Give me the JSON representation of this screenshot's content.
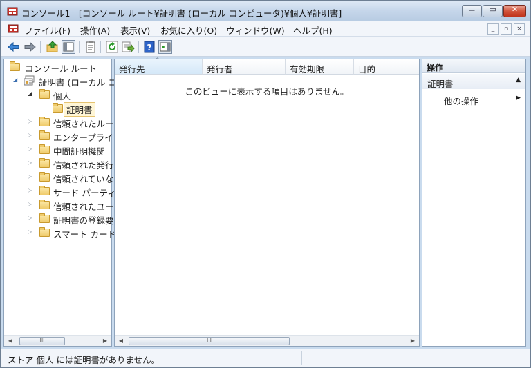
{
  "window": {
    "title": "コンソール1 - [コンソール ルート¥証明書 (ローカル コンピュータ)¥個人¥証明書]"
  },
  "caption_buttons": {
    "minimize": "－",
    "maximize": "▭",
    "close": "✕"
  },
  "menu": [
    "ファイル(F)",
    "操作(A)",
    "表示(V)",
    "お気に入り(O)",
    "ウィンドウ(W)",
    "ヘルプ(H)"
  ],
  "mdi_buttons": {
    "minimize": "_",
    "restore": "▫",
    "close": "×"
  },
  "toolbar": {
    "icons": [
      "back-icon",
      "forward-icon",
      "up-folder-icon",
      "show-hide-tree-icon",
      "properties-icon",
      "refresh-icon",
      "export-list-icon",
      "help-icon",
      "show-hide-action-pane-icon"
    ]
  },
  "tree": {
    "root": "コンソール ルート",
    "certificates": "証明書 (ローカル コ",
    "personal": "個人",
    "personal_certs": "証明書",
    "stores": [
      "信頼されたルー",
      "エンタープライ",
      "中間証明機関",
      "信頼された発行",
      "信頼されていな",
      "サード パーティ",
      "信頼されたユー",
      "証明書の登録要",
      "スマート カード"
    ],
    "scroll_thumb": "III"
  },
  "list": {
    "columns": [
      "発行先",
      "発行者",
      "有効期限",
      "目的"
    ],
    "empty_message": "このビューに表示する項目はありません。",
    "scroll_thumb": "III"
  },
  "actions": {
    "header": "操作",
    "section": "証明書",
    "item": "他の操作"
  },
  "status": {
    "text": "ストア 個人 には証明書がありません。"
  }
}
